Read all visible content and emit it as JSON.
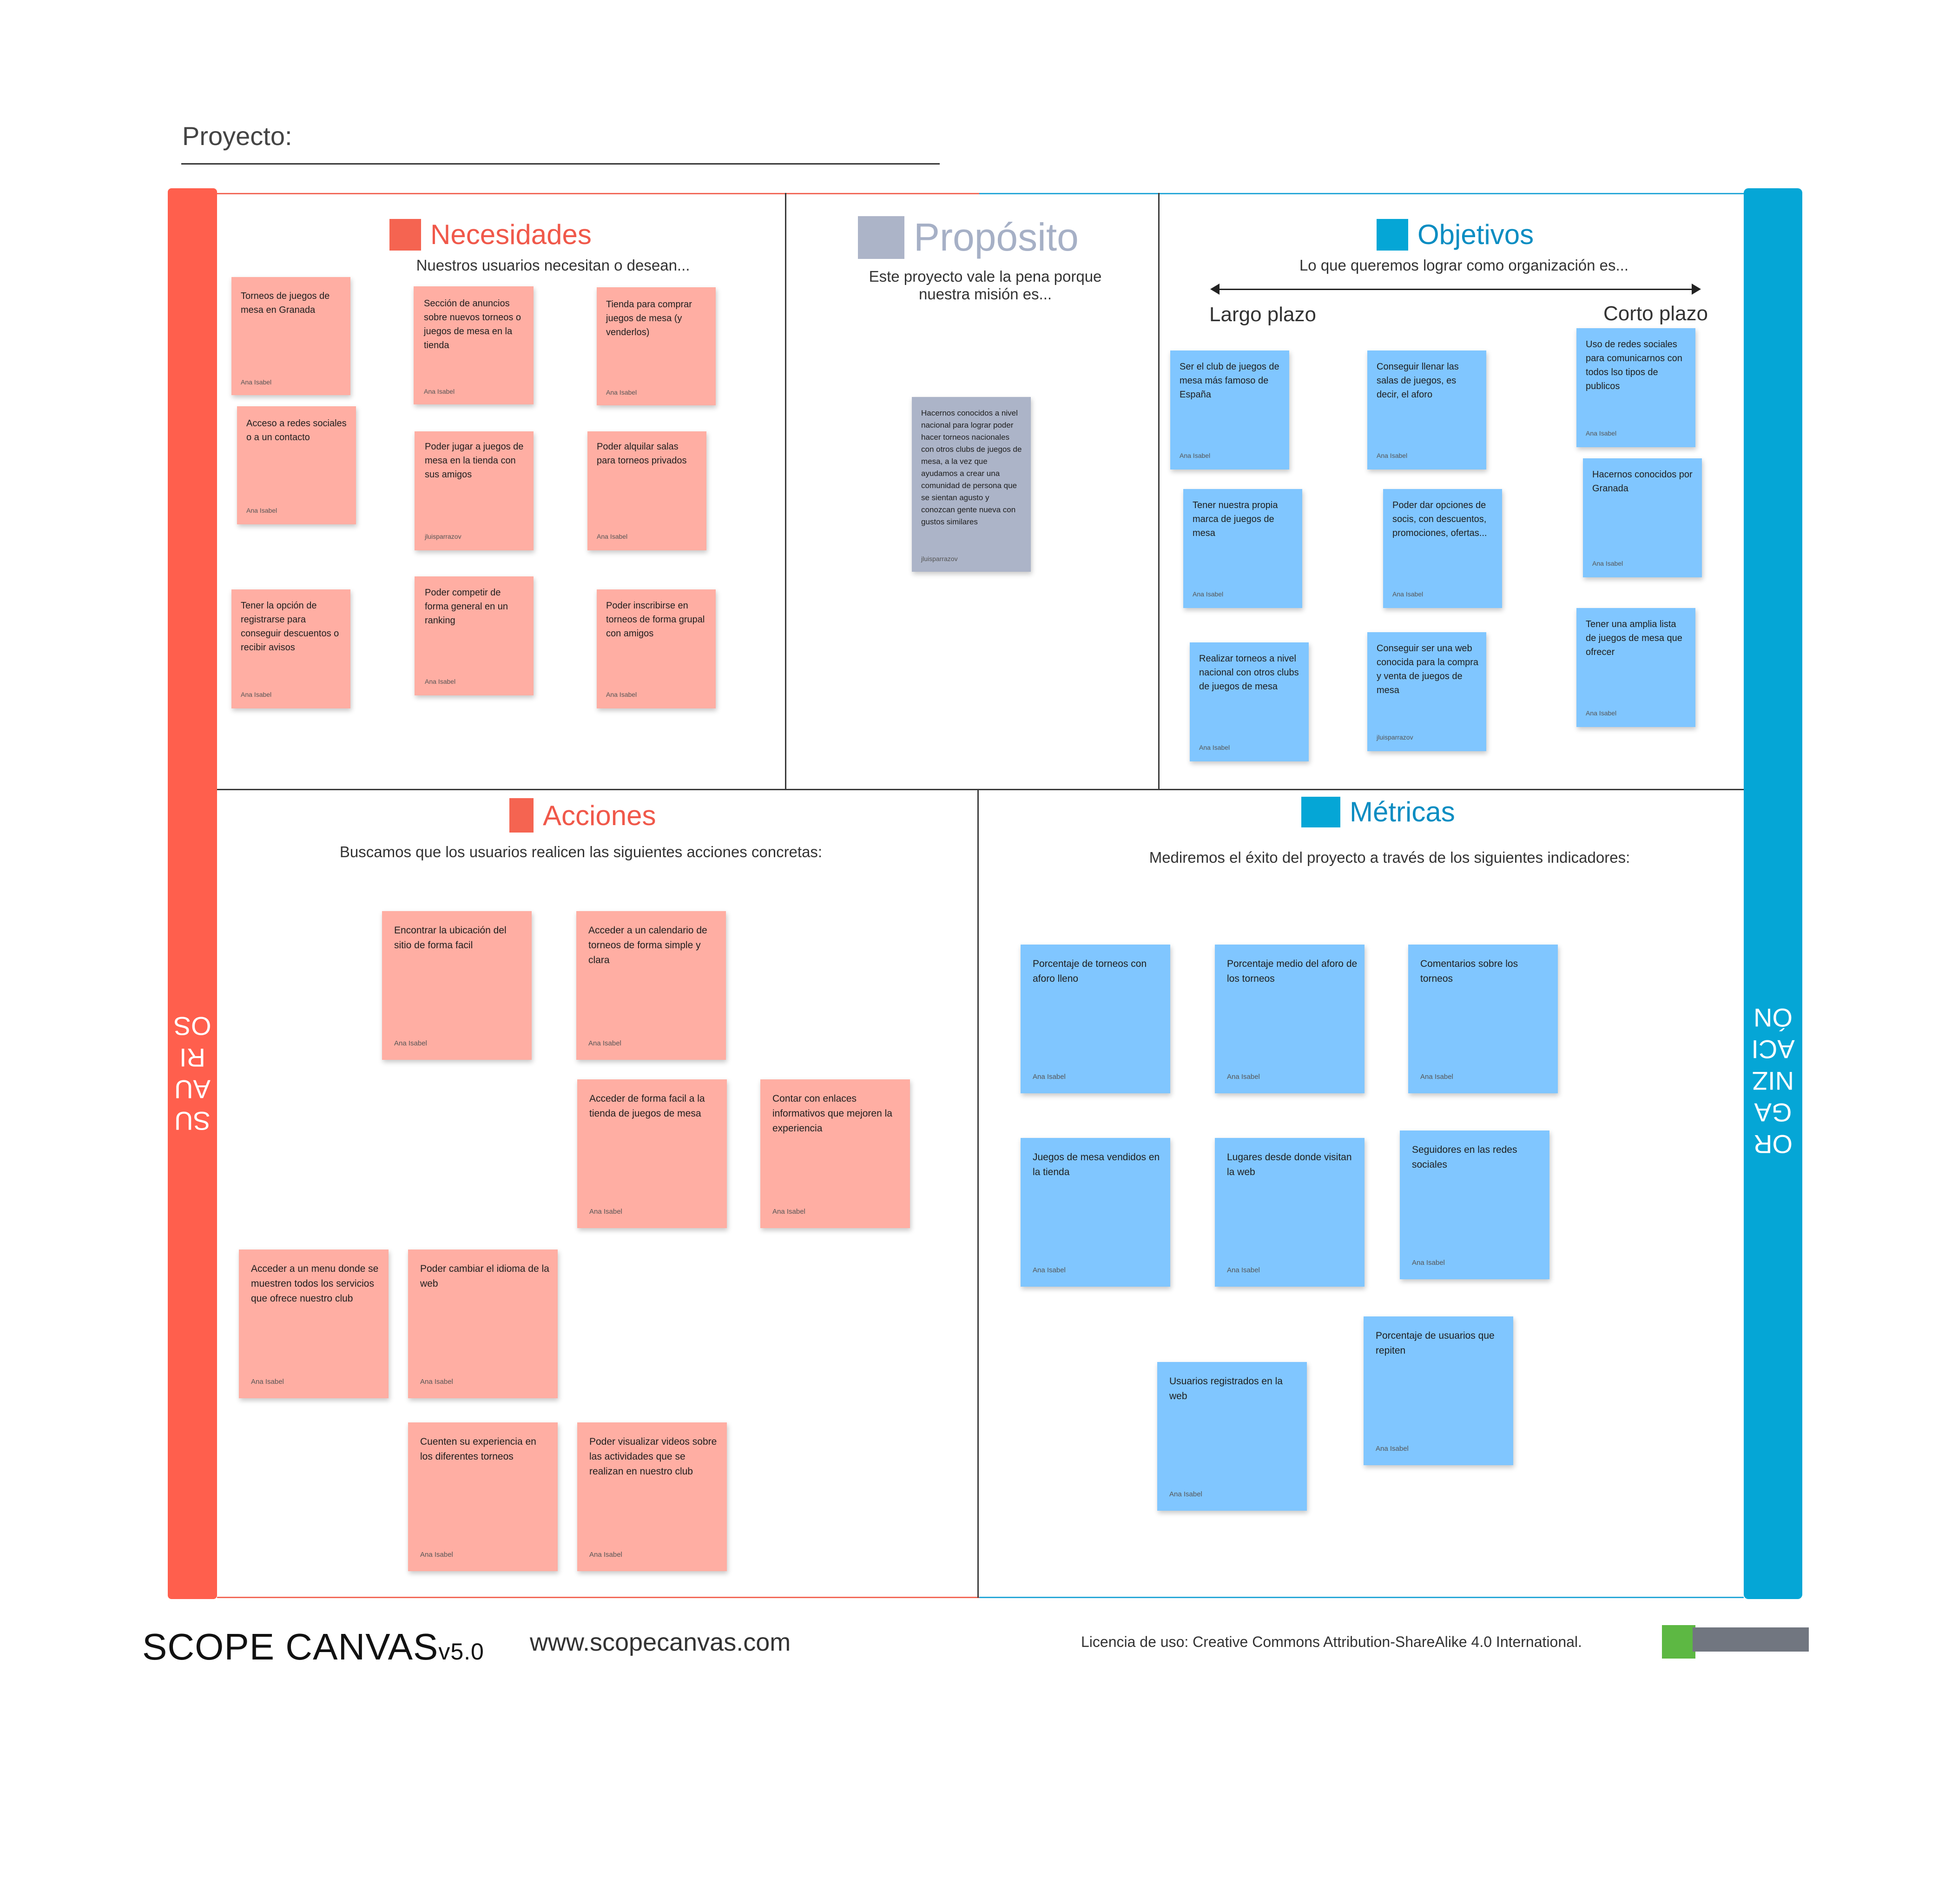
{
  "project": {
    "label": "Proyecto:"
  },
  "sidebars": {
    "left": [
      "SU",
      "AU",
      "RI",
      "OS"
    ],
    "right": [
      "OR",
      "GA",
      "NIZ",
      "ACI",
      "ÓN"
    ]
  },
  "colors": {
    "red": "#ff5f4d",
    "blue": "#05a6d6",
    "note_red": "#ffaea3",
    "note_blue": "#80c6ff",
    "note_gray": "#acb4c8"
  },
  "sections": {
    "necesidades": {
      "title": "Necesidades",
      "subtitle": "Nuestros usuarios necesitan o desean..."
    },
    "proposito": {
      "title": "Propósito",
      "subtitle_1": "Este proyecto vale la pena porque",
      "subtitle_2": "nuestra misión es..."
    },
    "objetivos": {
      "title": "Objetivos",
      "subtitle": "Lo que queremos lograr como organización es...",
      "long_term": "Largo plazo",
      "short_term": "Corto plazo"
    },
    "acciones": {
      "title": "Acciones",
      "subtitle": "Buscamos que los usuarios realicen las siguientes acciones concretas:"
    },
    "metricas": {
      "title": "Métricas",
      "subtitle": "Mediremos el éxito del proyecto a través de los siguientes indicadores:"
    }
  },
  "notes": {
    "necesidades": [
      {
        "text": "Torneos de juegos de mesa en Granada",
        "author": "Ana Isabel"
      },
      {
        "text": "Sección de anuncios sobre nuevos torneos o juegos de mesa en la tienda",
        "author": "Ana Isabel"
      },
      {
        "text": "Tienda para comprar juegos de mesa (y venderlos)",
        "author": "Ana Isabel"
      },
      {
        "text": "Acceso a redes sociales o a un contacto",
        "author": "Ana Isabel"
      },
      {
        "text": "Poder jugar a juegos de mesa en la tienda con sus amigos",
        "author": "jluisparrazov"
      },
      {
        "text": "Poder alquilar salas para torneos privados",
        "author": "Ana Isabel"
      },
      {
        "text": "Tener la opción de registrarse para conseguir descuentos o recibir avisos",
        "author": "Ana Isabel"
      },
      {
        "text": "Poder competir de forma general en un ranking",
        "author": "Ana Isabel"
      },
      {
        "text": "Poder inscribirse en torneos de forma grupal con amigos",
        "author": "Ana Isabel"
      }
    ],
    "proposito": [
      {
        "text": "Hacernos conocidos a nivel nacional para lograr poder hacer torneos nacionales con otros clubs de juegos de mesa, a la vez que ayudamos a crear una comunidad de persona que se sientan agusto y conozcan gente nueva con gustos similares",
        "author": "jluisparrazov"
      }
    ],
    "objetivos": [
      {
        "text": "Ser el club de juegos de mesa más famoso de España",
        "author": "Ana Isabel"
      },
      {
        "text": "Conseguir llenar las salas de juegos, es decir, el aforo",
        "author": "Ana Isabel"
      },
      {
        "text": "Uso de redes sociales para comunicarnos con  todos lso tipos de publicos",
        "author": "Ana Isabel"
      },
      {
        "text": "Tener  nuestra propia marca de juegos de mesa",
        "author": "Ana Isabel"
      },
      {
        "text": "Poder dar opciones de socis, con descuentos, promociones, ofertas...",
        "author": "Ana Isabel"
      },
      {
        "text": "Hacernos conocidos por Granada",
        "author": "Ana Isabel"
      },
      {
        "text": "Realizar torneos a nivel nacional con otros clubs de juegos de mesa",
        "author": "Ana Isabel"
      },
      {
        "text": "Conseguir ser una web conocida para la compra y venta de juegos de mesa",
        "author": "jluisparrazov"
      },
      {
        "text": "Tener una amplia lista de juegos de mesa que ofrecer",
        "author": "Ana Isabel"
      }
    ],
    "acciones": [
      {
        "text": "Encontrar la ubicación del sitio de forma facil",
        "author": "Ana Isabel"
      },
      {
        "text": "Acceder a un calendario de torneos de forma simple y clara",
        "author": "Ana Isabel"
      },
      {
        "text": "Acceder de forma facil a la tienda de juegos de mesa",
        "author": "Ana Isabel"
      },
      {
        "text": "Contar con enlaces informativos que mejoren la experiencia",
        "author": "Ana Isabel"
      },
      {
        "text": "Acceder a un menu donde se muestren todos los servicios que ofrece nuestro club",
        "author": "Ana Isabel"
      },
      {
        "text": "Poder cambiar el idioma de la web",
        "author": "Ana Isabel"
      },
      {
        "text": "Cuenten su experiencia en los diferentes torneos",
        "author": "Ana Isabel"
      },
      {
        "text": "Poder visualizar videos sobre las actividades que se realizan en nuestro club",
        "author": "Ana Isabel"
      }
    ],
    "metricas": [
      {
        "text": "Porcentaje de torneos con aforo lleno",
        "author": "Ana Isabel"
      },
      {
        "text": "Porcentaje medio del aforo de los torneos",
        "author": "Ana Isabel"
      },
      {
        "text": "Comentarios sobre los torneos",
        "author": "Ana Isabel"
      },
      {
        "text": "Juegos de mesa vendidos en la tienda",
        "author": "Ana Isabel"
      },
      {
        "text": "Lugares desde donde visitan la web",
        "author": "Ana Isabel"
      },
      {
        "text": "Seguidores en las redes sociales",
        "author": "Ana Isabel"
      },
      {
        "text": "Porcentaje de usuarios que repiten",
        "author": "Ana Isabel"
      },
      {
        "text": "Usuarios registrados en la web",
        "author": "Ana Isabel"
      }
    ]
  },
  "footer": {
    "brand": "SCOPE  CANVAS",
    "version": "v5.0",
    "url": "www.scopecanvas.com",
    "license": "Licencia de uso: Creative Commons Attribution-ShareAlike 4.0 International."
  }
}
